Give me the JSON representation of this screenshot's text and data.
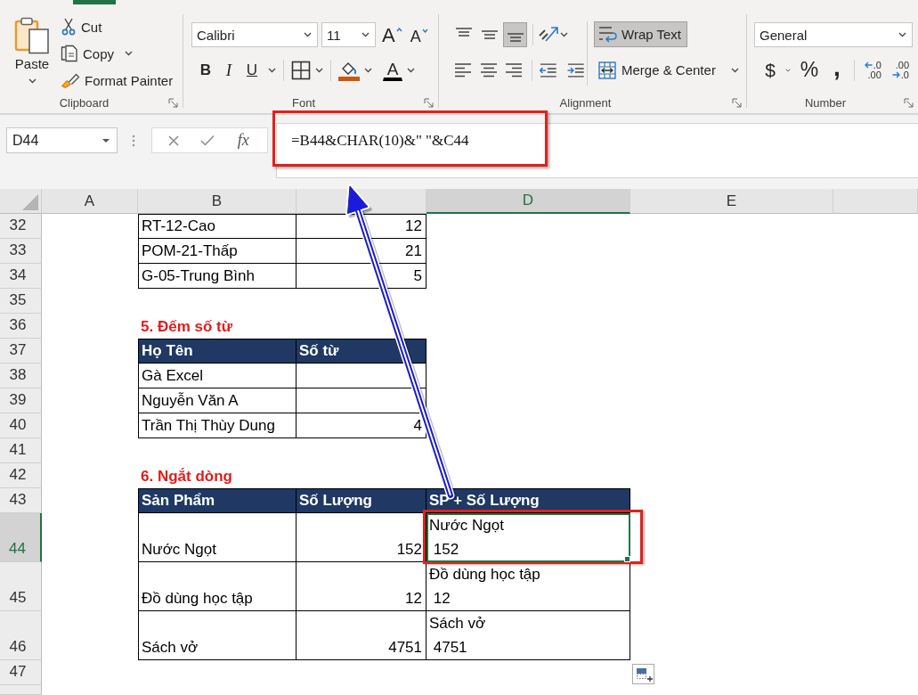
{
  "ribbon": {
    "clipboard": {
      "label": "Clipboard",
      "paste": "Paste",
      "commands": [
        {
          "kind": "cut",
          "label": "Cut",
          "dropdown": false
        },
        {
          "kind": "copy",
          "label": "Copy",
          "dropdown": true
        },
        {
          "kind": "format_painter",
          "label": "Format Painter",
          "dropdown": false
        }
      ]
    },
    "font": {
      "label": "Font",
      "font_name": "Calibri",
      "font_size": "11",
      "grow": "A",
      "shrink": "A",
      "styles": [
        {
          "kind": "bold",
          "label": "B",
          "dropdown": false
        },
        {
          "kind": "italic",
          "label": "I",
          "dropdown": false
        },
        {
          "kind": "underline",
          "label": "U",
          "dropdown": true
        }
      ],
      "font_color": "A"
    },
    "alignment": {
      "label": "Alignment",
      "vertical": [
        {
          "kind": "top",
          "selected": false
        },
        {
          "kind": "middle",
          "selected": false
        },
        {
          "kind": "bottom",
          "selected": true
        }
      ],
      "horizontal": [
        {
          "kind": "left",
          "selected": false
        },
        {
          "kind": "center",
          "selected": false
        },
        {
          "kind": "right",
          "selected": false
        }
      ],
      "wrap_text": {
        "label": "Wrap Text",
        "selected": true
      },
      "merge": "Merge & Center"
    },
    "number": {
      "label": "Number",
      "format": "General",
      "symbols": [
        {
          "kind": "currency",
          "label": "$",
          "dropdown": true
        },
        {
          "kind": "percent",
          "label": "%",
          "dropdown": false
        },
        {
          "kind": "comma",
          "label": ",",
          "dropdown": false
        }
      ],
      "decimals": [
        {
          "kind": "increase",
          "lines": [
            ".0",
            ".00"
          ]
        },
        {
          "kind": "decrease",
          "lines": [
            ".00",
            ".0"
          ]
        }
      ]
    }
  },
  "formula_bar": {
    "name_box": "D44",
    "function_label": "fx",
    "formula": "=B44&CHAR(10)&\" \"&C44"
  },
  "sheet": {
    "columns": [
      {
        "label": "A",
        "selected": false
      },
      {
        "label": "B",
        "selected": false
      },
      {
        "selected": false
      },
      {
        "label": "D",
        "selected": true
      },
      {
        "label": "E",
        "selected": false
      }
    ],
    "rows": [
      {
        "number": "32",
        "selected": false,
        "cells": [
          {
            "kind": "text",
            "value": "RT-12-Cao",
            "selected": false
          },
          {
            "kind": "number",
            "value": "12",
            "selected": false
          }
        ]
      },
      {
        "number": "33",
        "selected": false,
        "cells": [
          {
            "kind": "text",
            "value": "POM-21-Thấp",
            "selected": false
          },
          {
            "kind": "number",
            "value": "21",
            "selected": false
          }
        ]
      },
      {
        "number": "34",
        "selected": false,
        "cells": [
          {
            "kind": "text",
            "value": "G-05-Trung Bình",
            "selected": false
          },
          {
            "kind": "number",
            "value": "5",
            "selected": false
          }
        ]
      },
      {
        "number": "35",
        "selected": false
      },
      {
        "number": "36",
        "selected": false,
        "cells": [
          {
            "kind": "title",
            "value": "5. Đếm số từ",
            "selected": false
          }
        ]
      },
      {
        "number": "37",
        "selected": false,
        "cells": [
          {
            "kind": "header",
            "value": "Họ Tên",
            "selected": false
          },
          {
            "kind": "header",
            "value": "Số từ",
            "selected": false
          }
        ]
      },
      {
        "number": "38",
        "selected": false,
        "cells": [
          {
            "kind": "text",
            "value": "Gà Excel",
            "selected": false
          },
          {
            "kind": "number",
            "selected": false
          }
        ]
      },
      {
        "number": "39",
        "selected": false,
        "cells": [
          {
            "kind": "text",
            "value": "Nguyễn Văn A",
            "selected": false
          },
          {
            "kind": "number",
            "selected": false
          }
        ]
      },
      {
        "number": "40",
        "selected": false,
        "cells": [
          {
            "kind": "text",
            "value": "Trần Thị Thùy Dung",
            "selected": false
          },
          {
            "kind": "number",
            "value": "4",
            "selected": false
          }
        ]
      },
      {
        "number": "41",
        "selected": false
      },
      {
        "number": "42",
        "selected": false,
        "cells": [
          {
            "kind": "title",
            "value": "6. Ngắt dòng",
            "selected": false
          }
        ]
      },
      {
        "number": "43",
        "selected": false,
        "cells": [
          {
            "kind": "header",
            "value": "Sản Phẩm",
            "selected": false
          },
          {
            "kind": "header",
            "value": "Số Lượng",
            "selected": false
          },
          {
            "kind": "header",
            "value": "SP + Số Lượng",
            "selected": false
          }
        ]
      },
      {
        "number": "44",
        "selected": true,
        "cells": [
          {
            "kind": "text",
            "value": "Nước Ngọt",
            "selected": false
          },
          {
            "kind": "number",
            "value": "152",
            "selected": false
          },
          {
            "kind": "wrapped",
            "value": "Nước Ngọt\n 152",
            "selected": true
          }
        ]
      },
      {
        "number": "45",
        "selected": false,
        "cells": [
          {
            "kind": "text",
            "value": "Đồ dùng học tập",
            "selected": false
          },
          {
            "kind": "number",
            "value": "12",
            "selected": false
          },
          {
            "kind": "wrapped",
            "value": "Đồ dùng học tập\n 12",
            "selected": false
          }
        ]
      },
      {
        "number": "46",
        "selected": false,
        "cells": [
          {
            "kind": "text",
            "value": "Sách vở",
            "selected": false
          },
          {
            "kind": "number",
            "value": "4751",
            "selected": false
          },
          {
            "kind": "wrapped",
            "value": "Sách vở\n 4751",
            "selected": false
          }
        ]
      },
      {
        "number": "47",
        "selected": false
      }
    ]
  },
  "annotations": [
    {
      "kind": "formula_box"
    },
    {
      "kind": "cell_box"
    },
    {
      "kind": "arrow"
    }
  ]
}
